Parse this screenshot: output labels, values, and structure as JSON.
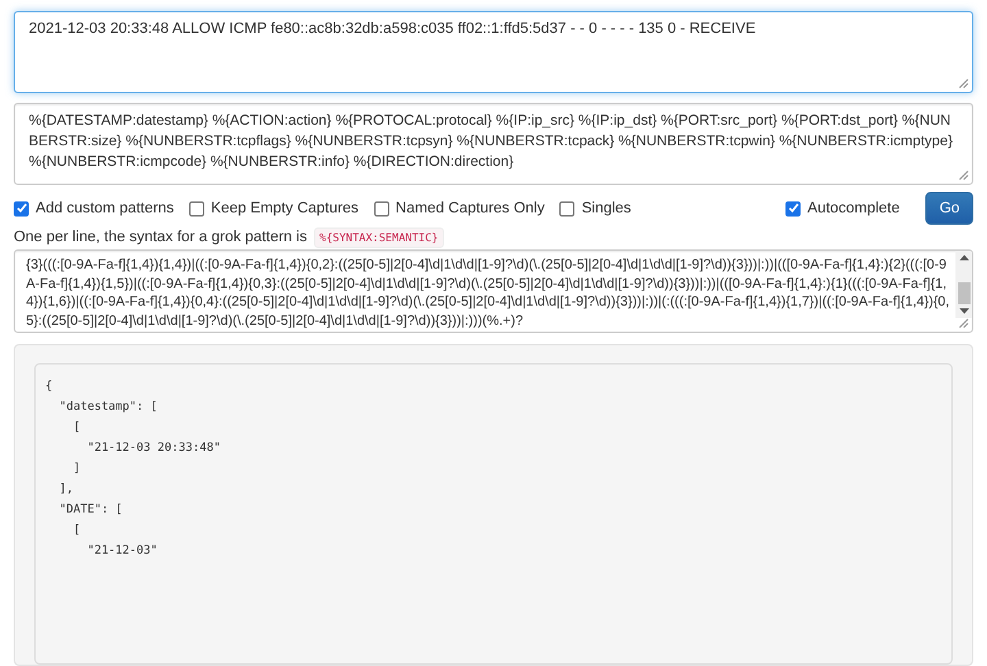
{
  "sample_input": {
    "value": "2021-12-03 20:33:48 ALLOW ICMP fe80::ac8b:32db:a598:c035 ff02::1:ffd5:5d37 - - 0 - - - - 135 0 - RECEIVE"
  },
  "pattern_input": {
    "value": "%{DATESTAMP:datestamp} %{ACTION:action} %{PROTOCAL:protocal} %{IP:ip_src} %{IP:ip_dst} %{PORT:src_port} %{PORT:dst_port} %{NUNBERSTR:size} %{NUNBERSTR:tcpflags} %{NUNBERSTR:tcpsyn} %{NUNBERSTR:tcpack} %{NUNBERSTR:tcpwin} %{NUNBERSTR:icmptype} %{NUNBERSTR:icmpcode} %{NUNBERSTR:info} %{DIRECTION:direction}"
  },
  "options": [
    {
      "label": "Add custom patterns",
      "checked": true
    },
    {
      "label": "Keep Empty Captures",
      "checked": false
    },
    {
      "label": "Named Captures Only",
      "checked": false
    },
    {
      "label": "Singles",
      "checked": false
    }
  ],
  "autocomplete": {
    "label": "Autocomplete",
    "checked": true
  },
  "go_button": {
    "label": "Go"
  },
  "help": {
    "text": "One per line, the syntax for a grok pattern is",
    "code": "%{SYNTAX:SEMANTIC}"
  },
  "custom_patterns": {
    "value": "{3}(((:[0-9A-Fa-f]{1,4}){1,4})|((:[0-9A-Fa-f]{1,4}){0,2}:((25[0-5]|2[0-4]\\d|1\\d\\d|[1-9]?\\d)(\\.(25[0-5]|2[0-4]\\d|1\\d\\d|[1-9]?\\d)){3}))|:))|(([0-9A-Fa-f]{1,4}:){2}(((:[0-9A-Fa-f]{1,4}){1,5})|((:[0-9A-Fa-f]{1,4}){0,3}:((25[0-5]|2[0-4]\\d|1\\d\\d|[1-9]?\\d)(\\.(25[0-5]|2[0-4]\\d|1\\d\\d|[1-9]?\\d)){3}))|:))|(([0-9A-Fa-f]{1,4}:){1}(((:[0-9A-Fa-f]{1,4}){1,6})|((:[0-9A-Fa-f]{1,4}){0,4}:((25[0-5]|2[0-4]\\d|1\\d\\d|[1-9]?\\d)(\\.(25[0-5]|2[0-4]\\d|1\\d\\d|[1-9]?\\d)){3}))|:))|(:(((:[0-9A-Fa-f]{1,4}){1,7})|((:[0-9A-Fa-f]{1,4}){0,5}:((25[0-5]|2[0-4]\\d|1\\d\\d|[1-9]?\\d)(\\.(25[0-5]|2[0-4]\\d|1\\d\\d|[1-9]?\\d)){3}))|:)))(%.+)?"
  },
  "output": {
    "lines": [
      "{",
      "  \"datestamp\": [",
      "    [",
      "      \"21-12-03 20:33:48\"",
      "    ]",
      "  ],",
      "  \"DATE\": [",
      "    [",
      "      \"21-12-03\""
    ]
  }
}
